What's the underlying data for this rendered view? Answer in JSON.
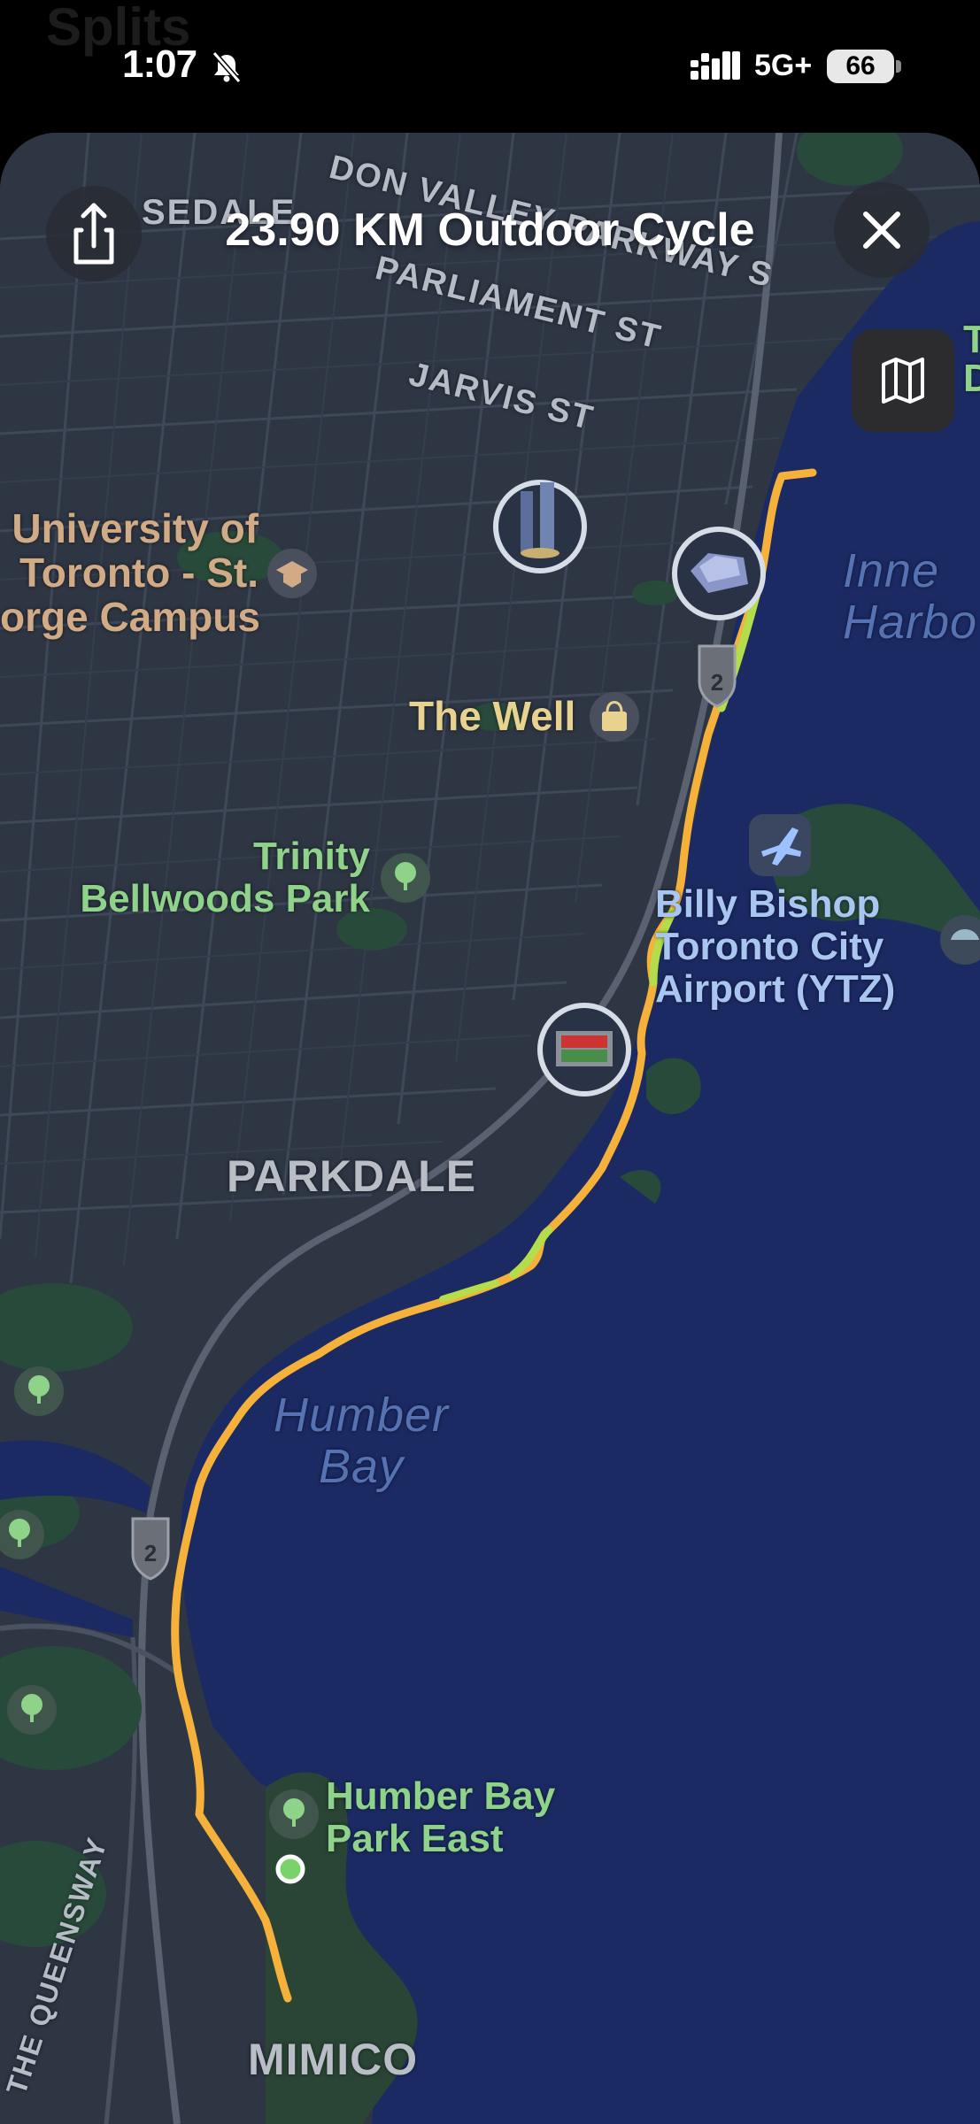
{
  "status_bar": {
    "time": "1:07",
    "network": "5G+",
    "battery": "66",
    "background_title": "Splits"
  },
  "header": {
    "title": "23.90 KM Outdoor Cycle",
    "share_icon": "share-icon",
    "close_icon": "close-icon",
    "map_mode_icon": "map-icon"
  },
  "map": {
    "streets": [
      "DON VALLEY PARKWAY S",
      "PARLIAMENT ST",
      "JARVIS ST",
      "THE QUEENSWAY",
      "SEDALE"
    ],
    "places": {
      "uoft_line1": "University of",
      "uoft_line2": "Toronto - St.",
      "uoft_line3": "orge Campus",
      "the_well": "The Well",
      "trinity_line1": "Trinity",
      "trinity_line2": "Bellwoods Park",
      "airport_line1": "Billy Bishop",
      "airport_line2": "Toronto City",
      "airport_line3": "Airport (YTZ)",
      "inner_line1": "Inne",
      "inner_line2": "Harbo",
      "humber_bay_line1": "Humber",
      "humber_bay_line2": "Bay",
      "park_line1": "Humber Bay",
      "park_line2": "Park East",
      "parkdale": "PARKDALE",
      "mimico": "MIMICO",
      "edge_top_right_1": "T",
      "edge_top_right_2": "D"
    },
    "highway_shield": "2",
    "colors": {
      "route": "#f5b13a",
      "route_fast": "#b5dc4a",
      "water": "#1b2a63",
      "land": "#2e3644",
      "park": "#284a3a",
      "start_dot": "#7ad26a"
    }
  }
}
